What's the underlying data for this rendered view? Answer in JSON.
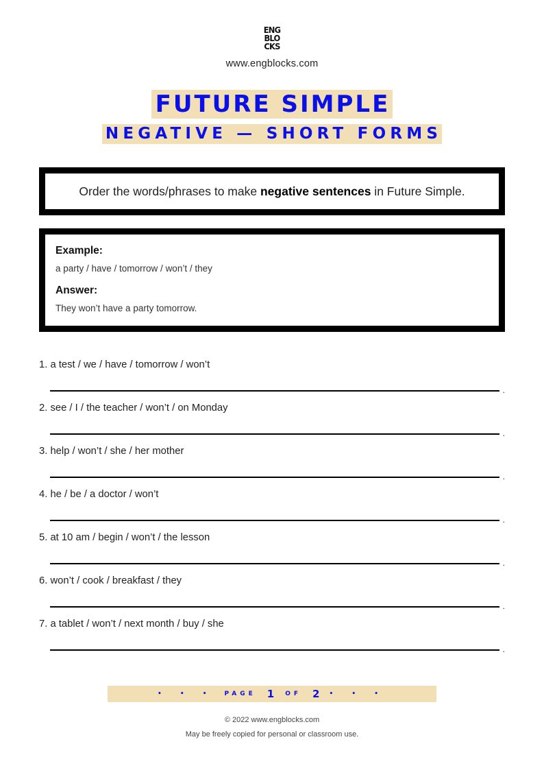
{
  "header": {
    "logo_lines": [
      "ENG",
      "BLO",
      "CKS"
    ],
    "site_url": "www.engblocks.com"
  },
  "title": "FUTURE SIMPLE",
  "subtitle": "NEGATIVE — SHORT FORMS",
  "instruction": {
    "before": "Order the words/phrases to make ",
    "bold": "negative sentences",
    "after": " in Future Simple."
  },
  "example": {
    "example_label": "Example:",
    "example_text": "a party / have / tomorrow / won’t / they",
    "answer_label": "Answer:",
    "answer_text": "They won’t have a party tomorrow."
  },
  "items": [
    {
      "prompt": "1. a test / we / have / tomorrow / won’t",
      "end_mark": "."
    },
    {
      "prompt": "2. see / I / the teacher / won’t / on Monday",
      "end_mark": "."
    },
    {
      "prompt": "3. help / won’t / she / her mother",
      "end_mark": "."
    },
    {
      "prompt": "4. he / be / a doctor / won’t",
      "end_mark": "."
    },
    {
      "prompt": "5. at 10 am / begin / won’t / the lesson",
      "end_mark": "."
    },
    {
      "prompt": "6. won’t / cook / breakfast / they",
      "end_mark": "."
    },
    {
      "prompt": "7. a tablet / won’t / next month / buy / she",
      "end_mark": "."
    }
  ],
  "pagination": {
    "dots_left": "• • •",
    "page_word": "PAGE",
    "current_page": "1",
    "of_word": "OF",
    "total_pages": "2",
    "dots_right": "• • •"
  },
  "footer": {
    "copyright": "© 2022 www.engblocks.com",
    "license": "May be freely copied for personal or classroom use."
  },
  "colors": {
    "accent_blue": "#0b10e6",
    "highlight_beige": "#f2dfb6",
    "border_black": "#000000"
  }
}
